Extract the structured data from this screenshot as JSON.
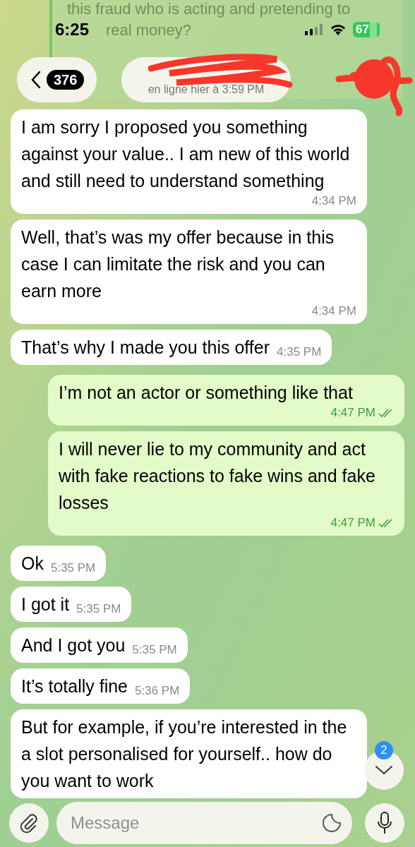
{
  "status_bar": {
    "time": "6:25",
    "battery": "67"
  },
  "background_message": {
    "lines": [
      "this fraud who is acting and pretending to",
      "real money?"
    ]
  },
  "header": {
    "unread_count": "376",
    "status": "en ligne hier à 3:59 PM"
  },
  "messages": [
    {
      "kind": "incoming",
      "text": "I am sorry I proposed you something against your value.. I am new of this world and still need to understand something",
      "time": "4:34 PM"
    },
    {
      "kind": "incoming",
      "text": "Well, that’s was my offer because in this case I can limitate the risk and you can earn more",
      "time": "4:34 PM"
    },
    {
      "kind": "incoming",
      "text": "That’s why I made you this offer",
      "time": "4:35 PM"
    },
    {
      "kind": "outgoing",
      "text": "I’m not an actor or something like that",
      "time": "4:47 PM",
      "read": true
    },
    {
      "kind": "outgoing",
      "text": "I will never lie to my community and act with fake reactions to fake wins and fake losses",
      "time": "4:47 PM",
      "read": true
    },
    {
      "kind": "incoming",
      "text": "Ok",
      "time": "5:35 PM"
    },
    {
      "kind": "incoming",
      "text": "I got it",
      "time": "5:35 PM"
    },
    {
      "kind": "incoming",
      "text": "And I got you",
      "time": "5:35 PM"
    },
    {
      "kind": "incoming",
      "text": "It’s totally fine",
      "time": "5:36 PM"
    },
    {
      "kind": "incoming",
      "text": "But for example, if you’re interested in the a slot personalised for yourself.. how do you want to work"
    }
  ],
  "scroll_down": {
    "badge": "2"
  },
  "composer": {
    "placeholder": "Message"
  }
}
